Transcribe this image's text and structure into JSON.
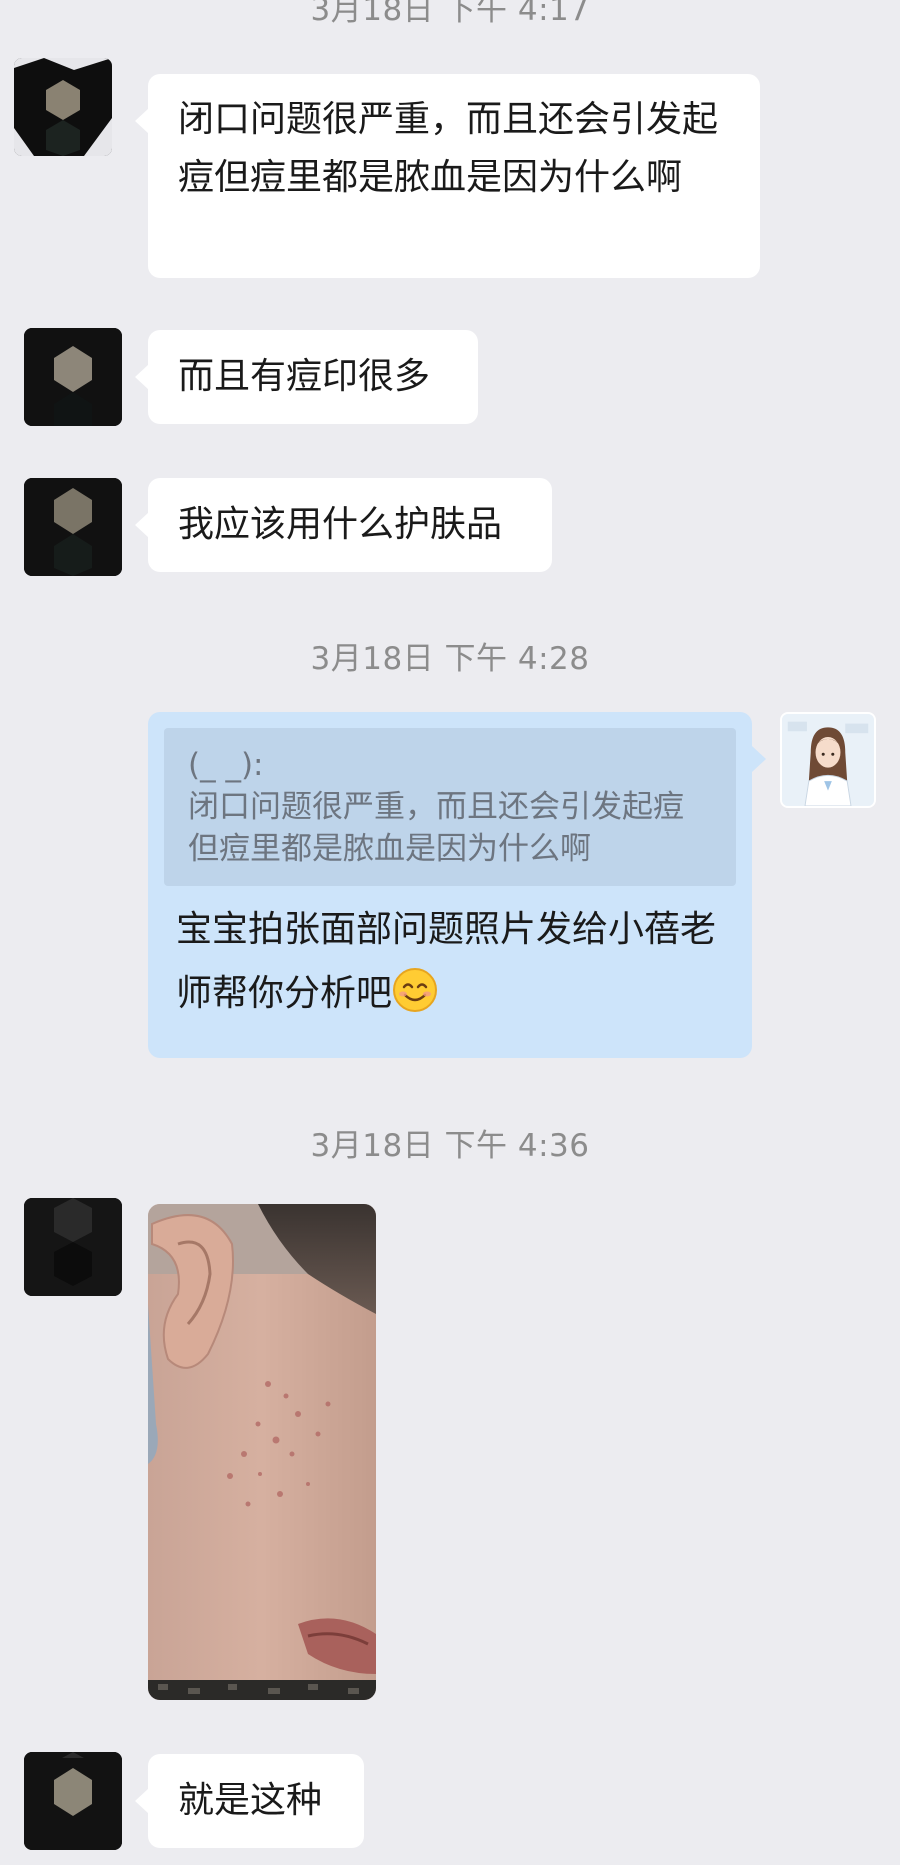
{
  "timestamps": [
    "3月18日  下午 4:17",
    "3月18日  下午 4:28",
    "3月18日  下午 4:36"
  ],
  "messages": [
    {
      "text": "闭口问题很严重，而且还会引发起痘但痘里都是脓血是因为什么啊"
    },
    {
      "text": "而且有痘印很多"
    },
    {
      "text": "我应该用什么护肤品"
    },
    {
      "quote_author": "(_ _):",
      "quote_text": "闭口问题很严重，而且还会引发起痘但痘里都是脓血是因为什么啊",
      "text": "宝宝拍张面部问题照片发给小蓓老师帮你分析吧",
      "emoji": "smiling-face-emoji"
    },
    {
      "image": "face-acne-photo"
    },
    {
      "text": "就是这种"
    }
  ],
  "colors": {
    "background": "#ececf0",
    "incoming_bubble": "#ffffff",
    "outgoing_bubble": "#cde4fa",
    "quote_block": "#bed4ea",
    "timestamp": "#8c8c8c"
  }
}
